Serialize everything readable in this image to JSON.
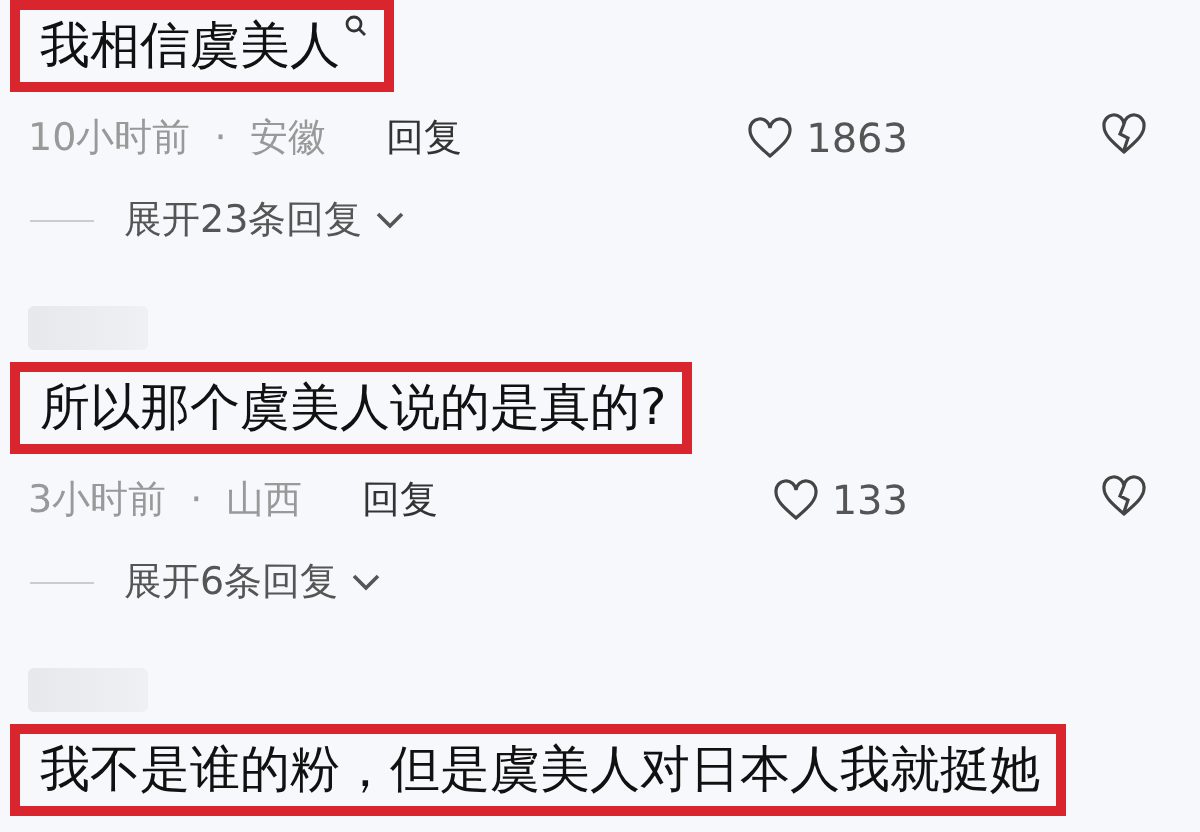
{
  "comments": [
    {
      "text": "我相信虞美人",
      "highlighted": true,
      "search_hint": true,
      "time": "10小时前",
      "separator": "·",
      "location": "安徽",
      "reply_label": "回复",
      "likes": "1863",
      "expand": "展开23条回复"
    },
    {
      "text": "所以那个虞美人说的是真的?",
      "highlighted": true,
      "search_hint": false,
      "time": "3小时前",
      "separator": "·",
      "location": "山西",
      "reply_label": "回复",
      "likes": "133",
      "expand": "展开6条回复"
    },
    {
      "text": "我不是谁的粉，但是虞美人对日本人我就挺她",
      "highlighted": true,
      "search_hint": false
    }
  ]
}
